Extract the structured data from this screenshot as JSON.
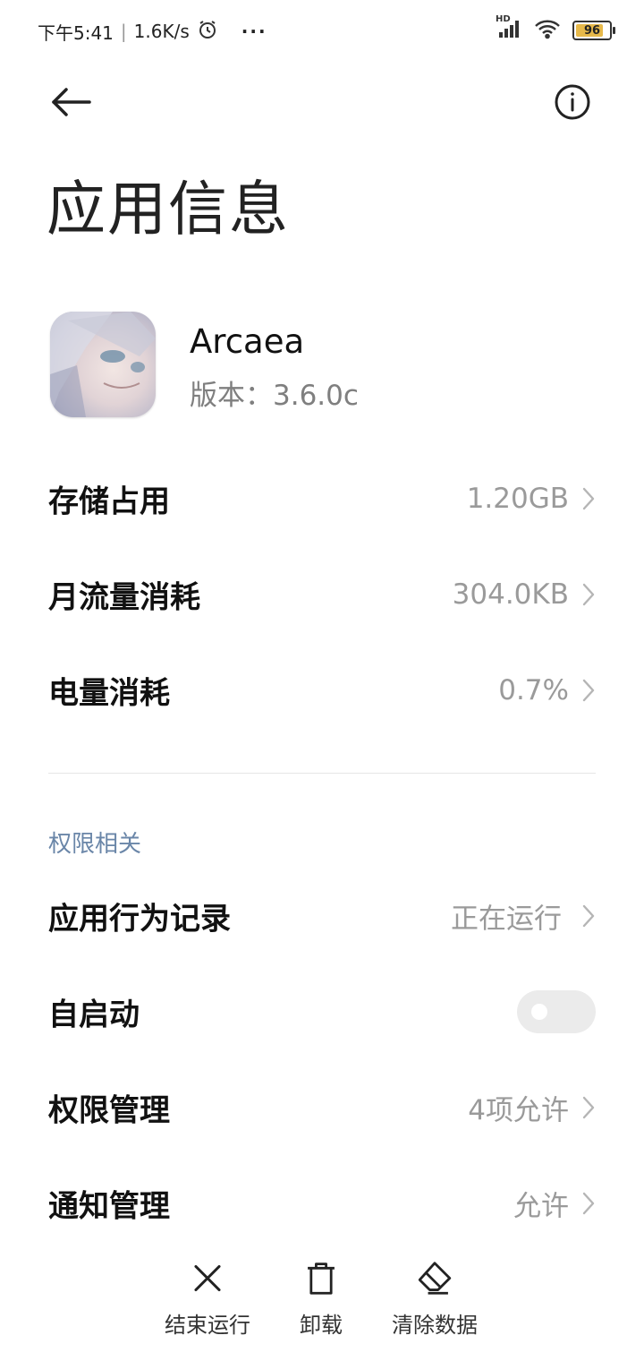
{
  "status_bar": {
    "time": "下午5:41",
    "speed": "1.6K/s",
    "more": "···",
    "hd": "HD",
    "battery": "96"
  },
  "header": {
    "title": "应用信息"
  },
  "app": {
    "name": "Arcaea",
    "version": "版本：3.6.0c"
  },
  "usage": [
    {
      "label": "存储占用",
      "value": "1.20GB"
    },
    {
      "label": "月流量消耗",
      "value": "304.0KB"
    },
    {
      "label": "电量消耗",
      "value": "0.7%"
    }
  ],
  "permissions": {
    "section_label": "权限相关",
    "behavior": {
      "label": "应用行为记录",
      "value": "正在运行"
    },
    "autostart": {
      "label": "自启动",
      "enabled": false
    },
    "manage": {
      "label": "权限管理",
      "value": "4项允许"
    },
    "notify": {
      "label": "通知管理",
      "value": "允许"
    }
  },
  "actions": [
    {
      "label": "结束运行",
      "icon": "close-icon"
    },
    {
      "label": "卸载",
      "icon": "trash-icon"
    },
    {
      "label": "清除数据",
      "icon": "eraser-icon"
    }
  ],
  "colors": {
    "accent_section": "#6a86a8",
    "value_gray": "#9a9a9a",
    "battery": "#e7b94a"
  }
}
